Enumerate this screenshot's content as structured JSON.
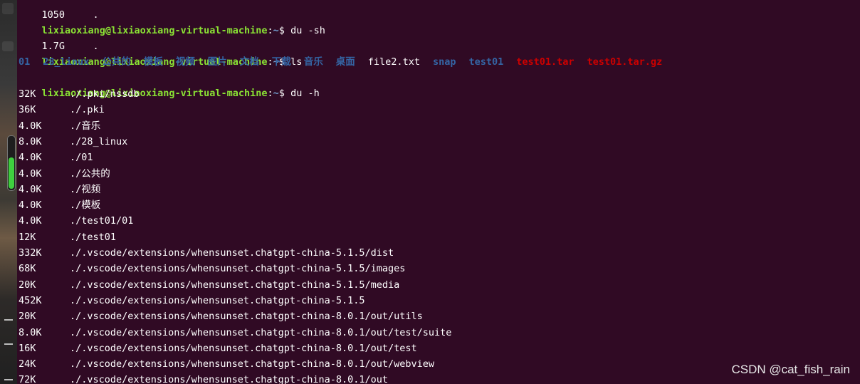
{
  "prompt": {
    "user_host": "lixiaoxiang@lixiaoxiang-virtual-machine",
    "colon": ":",
    "cwd": "~",
    "symbol": "$"
  },
  "top_partial": {
    "size": "1050",
    "path": "."
  },
  "commands": {
    "du_sh": "du -sh",
    "ls": "ls",
    "du_h": "du -h"
  },
  "du_sh_output": {
    "size": "1.7G",
    "path": "."
  },
  "ls_output": [
    {
      "name": "01",
      "type": "dir"
    },
    {
      "name": "28_linux",
      "type": "dir"
    },
    {
      "name": "公共的",
      "type": "dir"
    },
    {
      "name": "模板",
      "type": "dir"
    },
    {
      "name": "视频",
      "type": "dir"
    },
    {
      "name": "图片",
      "type": "dir"
    },
    {
      "name": "文档",
      "type": "dir"
    },
    {
      "name": "下载",
      "type": "dir"
    },
    {
      "name": "音乐",
      "type": "dir"
    },
    {
      "name": "桌面",
      "type": "dir"
    },
    {
      "name": "file2.txt",
      "type": "file"
    },
    {
      "name": "snap",
      "type": "dir"
    },
    {
      "name": "test01",
      "type": "dir"
    },
    {
      "name": "test01.tar",
      "type": "archive"
    },
    {
      "name": "test01.tar.gz",
      "type": "archive"
    }
  ],
  "du_h_output": [
    {
      "size": "32K",
      "path": "./.pki/nssdb"
    },
    {
      "size": "36K",
      "path": "./.pki"
    },
    {
      "size": "4.0K",
      "path": "./音乐"
    },
    {
      "size": "8.0K",
      "path": "./28_linux"
    },
    {
      "size": "4.0K",
      "path": "./01"
    },
    {
      "size": "4.0K",
      "path": "./公共的"
    },
    {
      "size": "4.0K",
      "path": "./视频"
    },
    {
      "size": "4.0K",
      "path": "./模板"
    },
    {
      "size": "4.0K",
      "path": "./test01/01"
    },
    {
      "size": "12K",
      "path": "./test01"
    },
    {
      "size": "332K",
      "path": "./.vscode/extensions/whensunset.chatgpt-china-5.1.5/dist"
    },
    {
      "size": "68K",
      "path": "./.vscode/extensions/whensunset.chatgpt-china-5.1.5/images"
    },
    {
      "size": "20K",
      "path": "./.vscode/extensions/whensunset.chatgpt-china-5.1.5/media"
    },
    {
      "size": "452K",
      "path": "./.vscode/extensions/whensunset.chatgpt-china-5.1.5"
    },
    {
      "size": "20K",
      "path": "./.vscode/extensions/whensunset.chatgpt-china-8.0.1/out/utils"
    },
    {
      "size": "8.0K",
      "path": "./.vscode/extensions/whensunset.chatgpt-china-8.0.1/out/test/suite"
    },
    {
      "size": "16K",
      "path": "./.vscode/extensions/whensunset.chatgpt-china-8.0.1/out/test"
    },
    {
      "size": "24K",
      "path": "./.vscode/extensions/whensunset.chatgpt-china-8.0.1/out/webview"
    },
    {
      "size": "72K",
      "path": "./.vscode/extensions/whensunset.chatgpt-china-8.0.1/out"
    }
  ],
  "watermark": "CSDN @cat_fish_rain",
  "colors": {
    "background": "#300a24",
    "user_host": "#8ae234",
    "cwd": "#729fcf",
    "directory": "#3465a4",
    "archive": "#cc0000",
    "text": "#ffffff"
  }
}
